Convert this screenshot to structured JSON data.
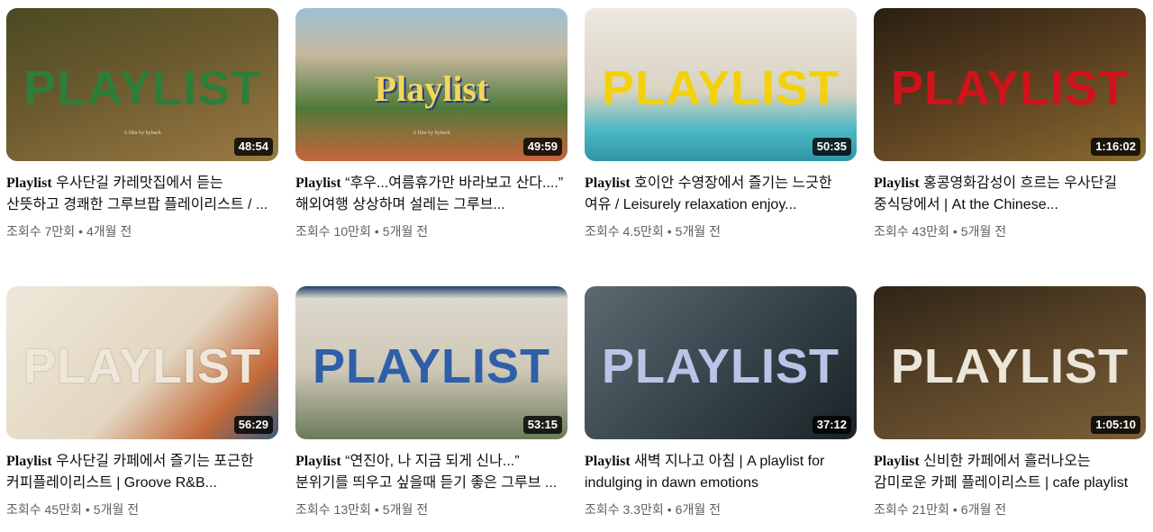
{
  "videos": [
    {
      "title_prefix": "Playlist",
      "title_rest": " 우사단길 카레맛집에서 듣는 산뜻하고 경쾌한 그루브팝 플레이리스트 / ...",
      "duration": "48:54",
      "views": "조회수 7만회",
      "age": "4개월 전",
      "thumb_text": "PLAYLIST",
      "thumb_credit": "A film by byback",
      "colors": {
        "bg1": "#5a5a2a",
        "bg2": "#8a6a3a",
        "text": "#2e7d3a"
      }
    },
    {
      "title_prefix": "Playlist",
      "title_rest": " “후우...여름휴가만 바라보고 산다....” 해외여행 상상하며 설레는 그루브...",
      "duration": "49:59",
      "views": "조회수 10만회",
      "age": "5개월 전",
      "thumb_text": "Playlist",
      "thumb_credit": "A film by byback",
      "colors": {
        "bg1": "#6e8fa0",
        "bg2": "#4f7a3a",
        "text": "#f2d75a"
      }
    },
    {
      "title_prefix": "Playlist",
      "title_rest": " 호이안 수영장에서 즐기는 느긋한 여유 / Leisurely relaxation enjoy...",
      "duration": "50:35",
      "views": "조회수 4.5만회",
      "age": "5개월 전",
      "thumb_text": "PLAYLIST",
      "thumb_credit": "",
      "colors": {
        "bg1": "#e8e4d8",
        "bg2": "#4ab8c4",
        "text": "#f3d10a"
      }
    },
    {
      "title_prefix": "Playlist",
      "title_rest": " 홍콩영화감성이 흐르는 우사단길 중식당에서 | At the Chinese...",
      "duration": "1:16:02",
      "views": "조회수 43만회",
      "age": "5개월 전",
      "thumb_text": "PLAYLIST",
      "thumb_credit": "",
      "colors": {
        "bg1": "#3a2a1a",
        "bg2": "#7a5a2a",
        "text": "#d0121a"
      }
    },
    {
      "title_prefix": "Playlist",
      "title_rest": " 우사단길 카페에서 즐기는 포근한 커피플레이리스트 | Groove R&B...",
      "duration": "56:29",
      "views": "조회수 45만회",
      "age": "5개월 전",
      "thumb_text": "PLAYLIST",
      "thumb_credit": "",
      "colors": {
        "bg1": "#e9e1d3",
        "bg2": "#c46a3a",
        "text": "#efe7da"
      }
    },
    {
      "title_prefix": "Playlist",
      "title_rest": " “연진아, 나 지금 되게 신나...” 분위기를 띄우고 싶을때 듣기 좋은 그루브 ...",
      "duration": "53:15",
      "views": "조회수 13만회",
      "age": "5개월 전",
      "thumb_text": "PLAYLIST",
      "thumb_credit": "",
      "colors": {
        "bg1": "#d8d4c8",
        "bg2": "#6a7a5a",
        "text": "#2f5fa8"
      }
    },
    {
      "title_prefix": "Playlist",
      "title_rest": " 새벽 지나고 아침 | A playlist for indulging in dawn emotions",
      "duration": "37:12",
      "views": "조회수 3.3만회",
      "age": "6개월 전",
      "thumb_text": "PLAYLIST",
      "thumb_credit": "",
      "colors": {
        "bg1": "#3a4a50",
        "bg2": "#1a2226",
        "text": "#b9c4e8"
      }
    },
    {
      "title_prefix": "Playlist",
      "title_rest": " 신비한 카페에서 흘러나오는 감미로운 카페 플레이리스트 | cafe playlist",
      "duration": "1:05:10",
      "views": "조회수 21만회",
      "age": "6개월 전",
      "thumb_text": "PLAYLIST",
      "thumb_credit": "",
      "colors": {
        "bg1": "#3a2e1e",
        "bg2": "#6a5030",
        "text": "#ece6da"
      }
    }
  ]
}
